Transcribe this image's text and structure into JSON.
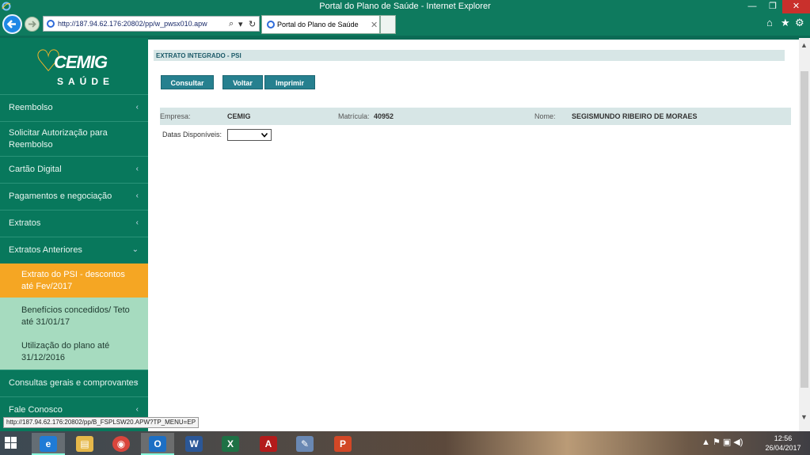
{
  "window": {
    "title": "Portal do Plano de Saúde - Internet Explorer",
    "min": "—",
    "max": "❐",
    "close": "✕"
  },
  "browser": {
    "url": "http://187.94.62.176:20802/pp/w_pwsx010.apw",
    "tab_title": "Portal do Plano de Saúde",
    "tab_close": "✕",
    "search_icon": "⌕",
    "dropdown_icon": "▾",
    "refresh_icon": "↻",
    "home_icon": "⌂",
    "favorites_icon": "★",
    "settings_icon": "⚙",
    "status_url": "http://187.94.62.176:20802/pp/B_FSPLSW20.APW?TP_MENU=EP"
  },
  "sidebar": {
    "logo_brand": "CEMIG",
    "logo_sub": "SAÚDE",
    "items": [
      {
        "label": "Reembolso",
        "chevron": "‹"
      },
      {
        "label": "Solicitar Autorização para Reembolso",
        "chevron": ""
      },
      {
        "label": "Cartão Digital",
        "chevron": "‹"
      },
      {
        "label": "Pagamentos e negociação",
        "chevron": "‹"
      },
      {
        "label": "Extratos",
        "chevron": "‹"
      },
      {
        "label": "Extratos Anteriores",
        "chevron": "⌄"
      },
      {
        "label": "Extrato do PSI - descontos até Fev/2017",
        "chevron": ""
      },
      {
        "label": "Benefícios concedidos/ Teto até 31/01/17",
        "chevron": ""
      },
      {
        "label": "Utilização do plano até 31/12/2016",
        "chevron": ""
      },
      {
        "label": "Consultas gerais e comprovantes",
        "chevron": "‹"
      },
      {
        "label": "Fale Conosco",
        "chevron": "‹"
      }
    ]
  },
  "main": {
    "header": "EXTRATO INTEGRADO - PSI",
    "buttons": {
      "consultar": "Consultar",
      "voltar": "Voltar",
      "imprimir": "Imprimir"
    },
    "info": {
      "empresa_label": "Empresa:",
      "empresa_value": "CEMIG",
      "matricula_label": "Matrícula:",
      "matricula_value": "40952",
      "nome_label": "Nome:",
      "nome_value": "SEGISMUNDO RIBEIRO DE MORAES"
    },
    "datas_label": "Datas Disponíveis:",
    "datas_value": ""
  },
  "taskbar": {
    "time": "12:56",
    "date": "26/04/2017",
    "tray": "▲ ⚑ ▣ ◀)",
    "apps": [
      {
        "name": "Internet Explorer",
        "glyph": "e",
        "color": "#1f7bd6"
      },
      {
        "name": "File Explorer",
        "glyph": "▤",
        "color": "#e6b84a"
      },
      {
        "name": "Google Chrome",
        "glyph": "◉",
        "color": "#d9453c"
      },
      {
        "name": "Outlook",
        "glyph": "O",
        "color": "#1d6fc4"
      },
      {
        "name": "Word",
        "glyph": "W",
        "color": "#2b5797"
      },
      {
        "name": "Excel",
        "glyph": "X",
        "color": "#1e7145"
      },
      {
        "name": "Acrobat",
        "glyph": "A",
        "color": "#b31b1b"
      },
      {
        "name": "Paint",
        "glyph": "✎",
        "color": "#6a88b3"
      },
      {
        "name": "PowerPoint",
        "glyph": "P",
        "color": "#d24726"
      }
    ]
  }
}
